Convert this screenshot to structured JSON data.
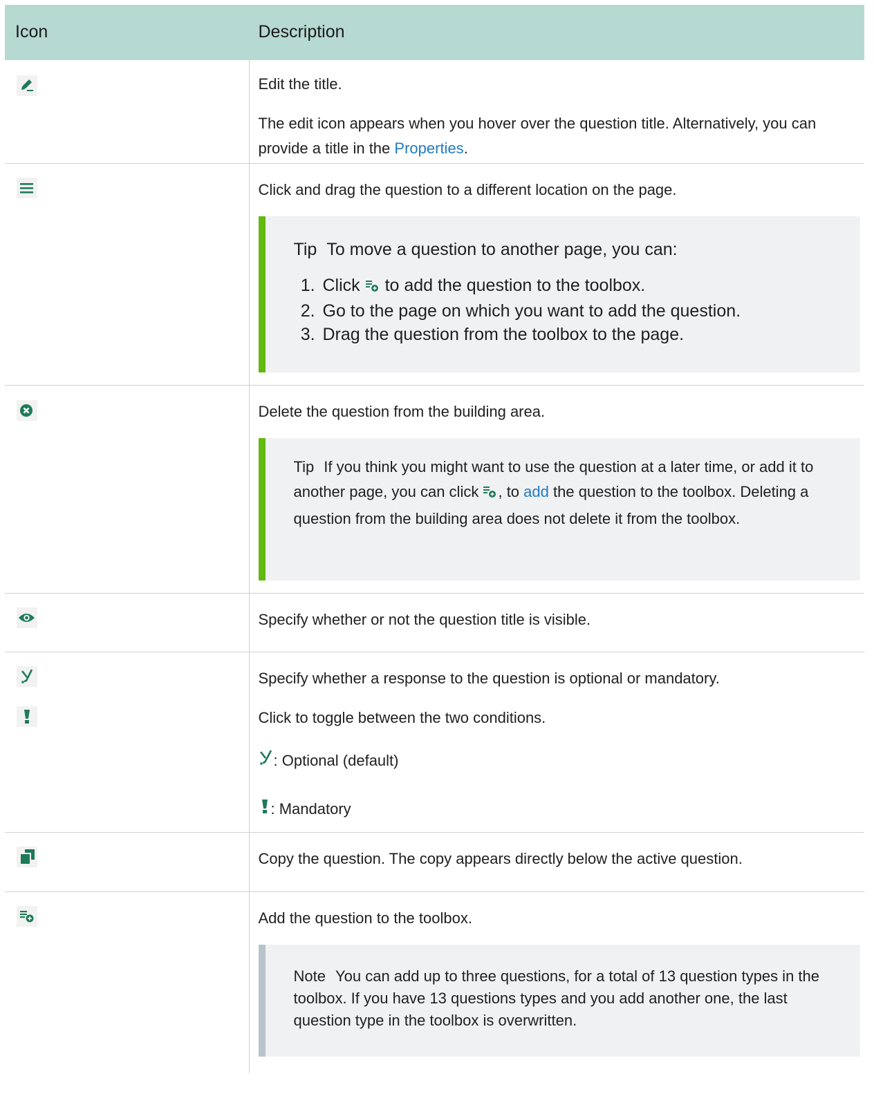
{
  "header": {
    "icon": "Icon",
    "description": "Description"
  },
  "rows": {
    "edit": {
      "icon": "edit-pencil-icon",
      "line1": "Edit the title.",
      "line2_before": "The edit icon appears when you hover over the question title. Alternatively, you can provide a title in the ",
      "line2_link": "Properties",
      "line2_after": "."
    },
    "drag": {
      "icon": "drag-handle-icon",
      "line1": "Click and drag the question to a different location on the page.",
      "tip_label": "Tip",
      "tip_text": "To move a question to another page, you can:",
      "step1_before": "Click",
      "step1_icon": "add-to-toolbox-icon",
      "step1_after": "to add the question to the toolbox.",
      "step2": "Go to the page on which you want to add the question.",
      "step3": "Drag the question from the toolbox to the page."
    },
    "delete": {
      "icon": "delete-circle-icon",
      "line1": "Delete the question from the building area.",
      "tip_label": "Tip",
      "tip_before": "If you think you might want to use the question at a later time, or add it to another page, you can click",
      "tip_icon": "add-to-toolbox-icon",
      "tip_mid": ", to",
      "tip_link": "add",
      "tip_after": "the question to the toolbox. Deleting a question from the building area does not delete it from the toolbox."
    },
    "visibility": {
      "icon": "eye-icon",
      "line1": "Specify whether or not the question title is visible."
    },
    "mandatory": {
      "icon_optional": "optional-icon",
      "icon_mandatory": "mandatory-exclamation-icon",
      "line1": "Specify whether a response to the question is optional or mandatory.",
      "line2": "Click to toggle between the two conditions.",
      "optional_label": ": Optional (default)",
      "mandatory_label": ": Mandatory"
    },
    "copy": {
      "icon": "copy-icon",
      "line1": "Copy the question. The copy appears directly below the active question."
    },
    "toolbox": {
      "icon": "add-to-toolbox-icon",
      "line1": "Add the question to the toolbox.",
      "note_label": "Note",
      "note_text": "You can add up to three questions, for a total of 13 question types in the toolbox. If you have 13 questions types and you add another one, the last question type in the toolbox is overwritten."
    }
  },
  "colors": {
    "header_bg": "#b6d9d1",
    "icon_green": "#1e7a58",
    "link_blue": "#1f7bbf",
    "tip_bar": "#62b90f",
    "note_bar": "#bac2cb",
    "callout_bg": "#f0f1f3"
  }
}
